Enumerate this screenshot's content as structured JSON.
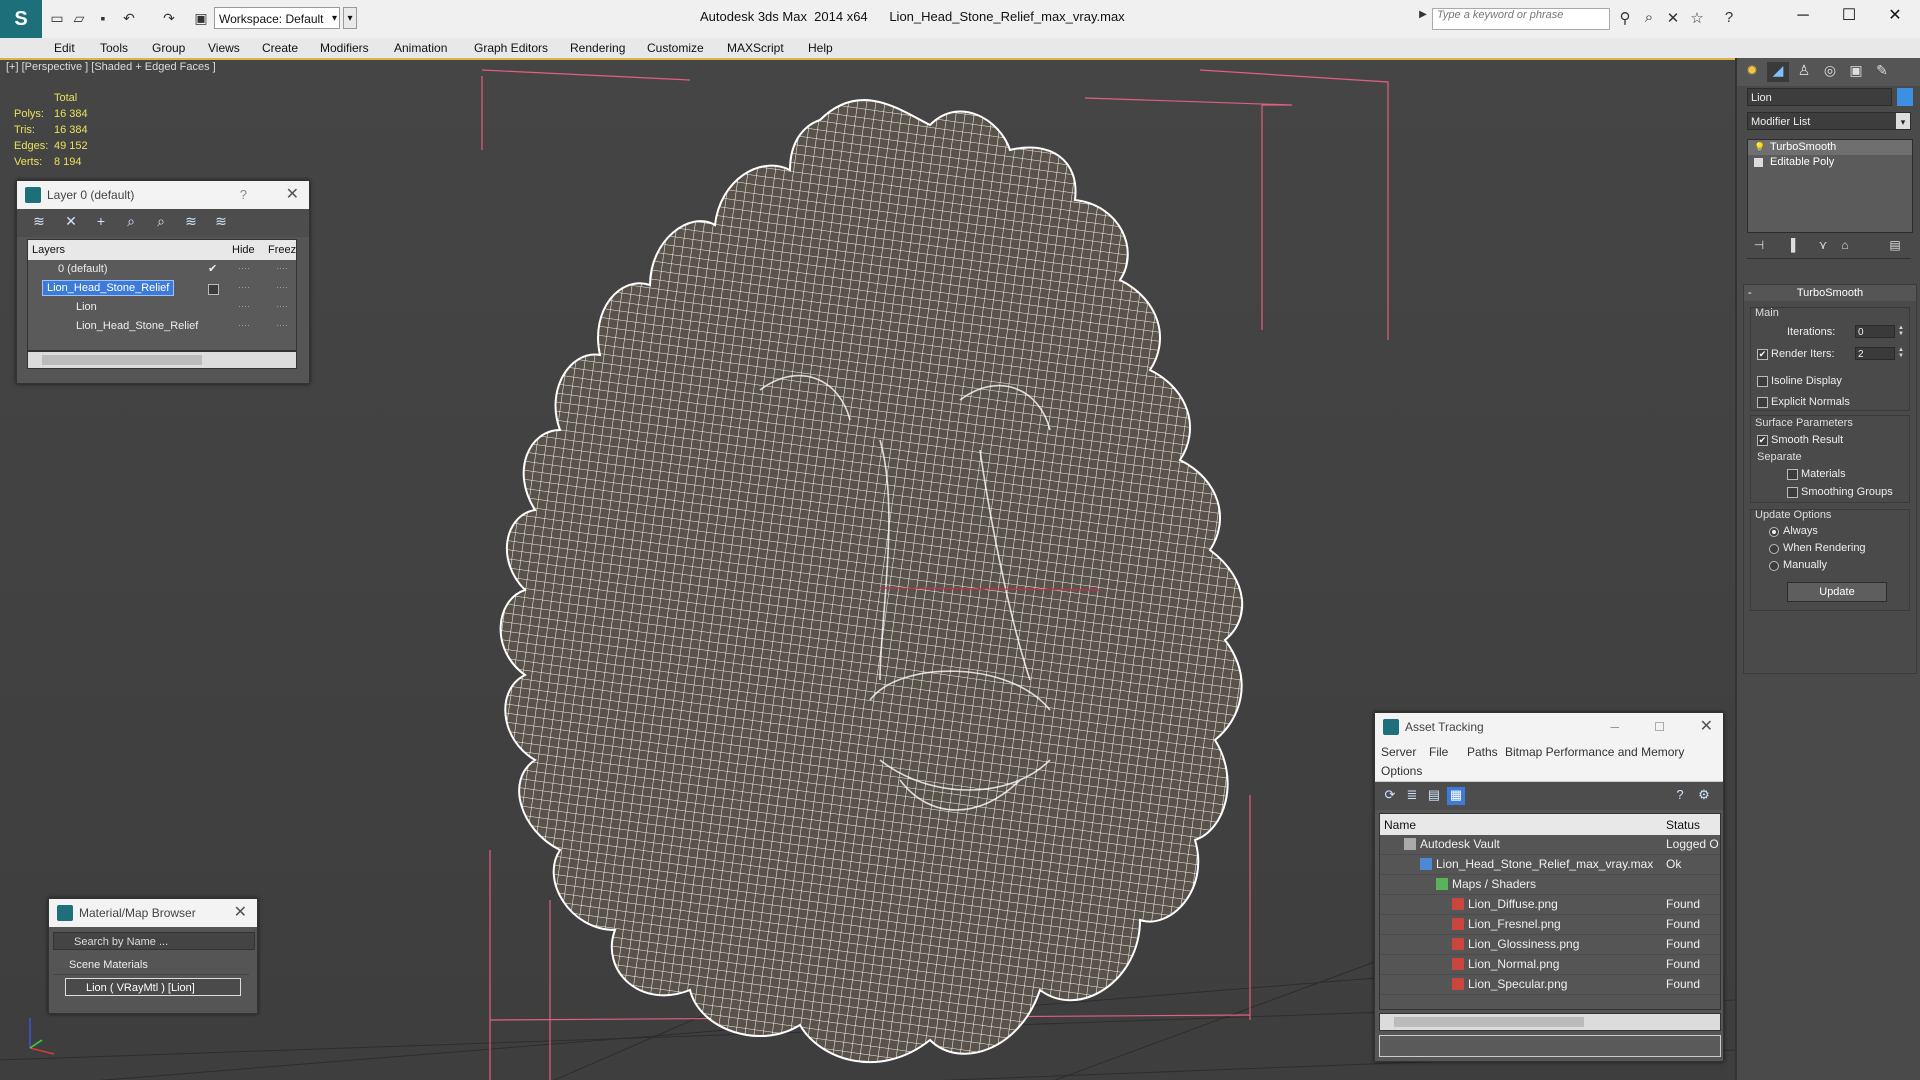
{
  "titlebar": {
    "workspace": "Workspace: Default",
    "app_title": "Autodesk 3ds Max  2014 x64      Lion_Head_Stone_Relief_max_vray.max",
    "search_placeholder": "Type a keyword or phrase"
  },
  "menu": [
    "Edit",
    "Tools",
    "Group",
    "Views",
    "Create",
    "Modifiers",
    "Animation",
    "Graph Editors",
    "Rendering",
    "Customize",
    "MAXScript",
    "Help"
  ],
  "viewport": {
    "label": "[+] [Perspective ] [Shaded + Edged Faces ]",
    "stats_header": "Total",
    "stats": [
      {
        "k": "Polys:",
        "v": "16 384"
      },
      {
        "k": "Tris:",
        "v": "16 384"
      },
      {
        "k": "Edges:",
        "v": "49 152"
      },
      {
        "k": "Verts:",
        "v": "8 194"
      }
    ]
  },
  "layer_panel": {
    "title": "Layer 0 (default)",
    "help": "?",
    "columns": {
      "layers": "Layers",
      "hide": "Hide",
      "freeze": "Freeze"
    },
    "rows": [
      {
        "name": "0 (default)",
        "level": 0
      },
      {
        "name": "Lion_Head_Stone_Relief",
        "level": 0
      },
      {
        "name": "Lion",
        "level": 1
      },
      {
        "name": "Lion_Head_Stone_Relief",
        "level": 1
      }
    ]
  },
  "material_browser": {
    "title": "Material/Map Browser",
    "search_placeholder": "Search by Name ...",
    "group": "Scene Materials",
    "item": "Lion  ( VRayMtl )  [Lion]"
  },
  "asset_tracking": {
    "title": "Asset Tracking",
    "menu": [
      "Server",
      "File",
      "Paths",
      "Bitmap Performance and Memory",
      "Options"
    ],
    "columns": {
      "name": "Name",
      "status": "Status"
    },
    "rows": [
      {
        "name": "Autodesk Vault",
        "status": "Logged O",
        "indent": 1
      },
      {
        "name": "Lion_Head_Stone_Relief_max_vray.max",
        "status": "Ok",
        "indent": 2
      },
      {
        "name": "Maps / Shaders",
        "status": "",
        "indent": 3
      },
      {
        "name": "Lion_Diffuse.png",
        "status": "Found",
        "indent": 4
      },
      {
        "name": "Lion_Fresnel.png",
        "status": "Found",
        "indent": 4
      },
      {
        "name": "Lion_Glossiness.png",
        "status": "Found",
        "indent": 4
      },
      {
        "name": "Lion_Normal.png",
        "status": "Found",
        "indent": 4
      },
      {
        "name": "Lion_Specular.png",
        "status": "Found",
        "indent": 4
      }
    ]
  },
  "command_panel": {
    "object_name": "Lion",
    "modifier_list": "Modifier List",
    "stack": [
      "TurboSmooth",
      "Editable Poly"
    ],
    "turbosmooth": {
      "title": "TurboSmooth",
      "main_label": "Main",
      "iterations_label": "Iterations:",
      "iterations_value": "0",
      "render_iters_label": "Render Iters:",
      "render_iters_value": "2",
      "isoline": "Isoline Display",
      "explicit_normals": "Explicit Normals",
      "surface_label": "Surface Parameters",
      "smooth_result": "Smooth Result",
      "separate_label": "Separate",
      "materials": "Materials",
      "smoothing_groups": "Smoothing Groups",
      "update_label": "Update Options",
      "always": "Always",
      "when_rendering": "When Rendering",
      "manually": "Manually",
      "update_button": "Update"
    }
  },
  "colors": {
    "accent": "#d9b44a",
    "selection": "#3d7bd8",
    "mesh": "#ffffff",
    "bounding": "#e0607e"
  }
}
